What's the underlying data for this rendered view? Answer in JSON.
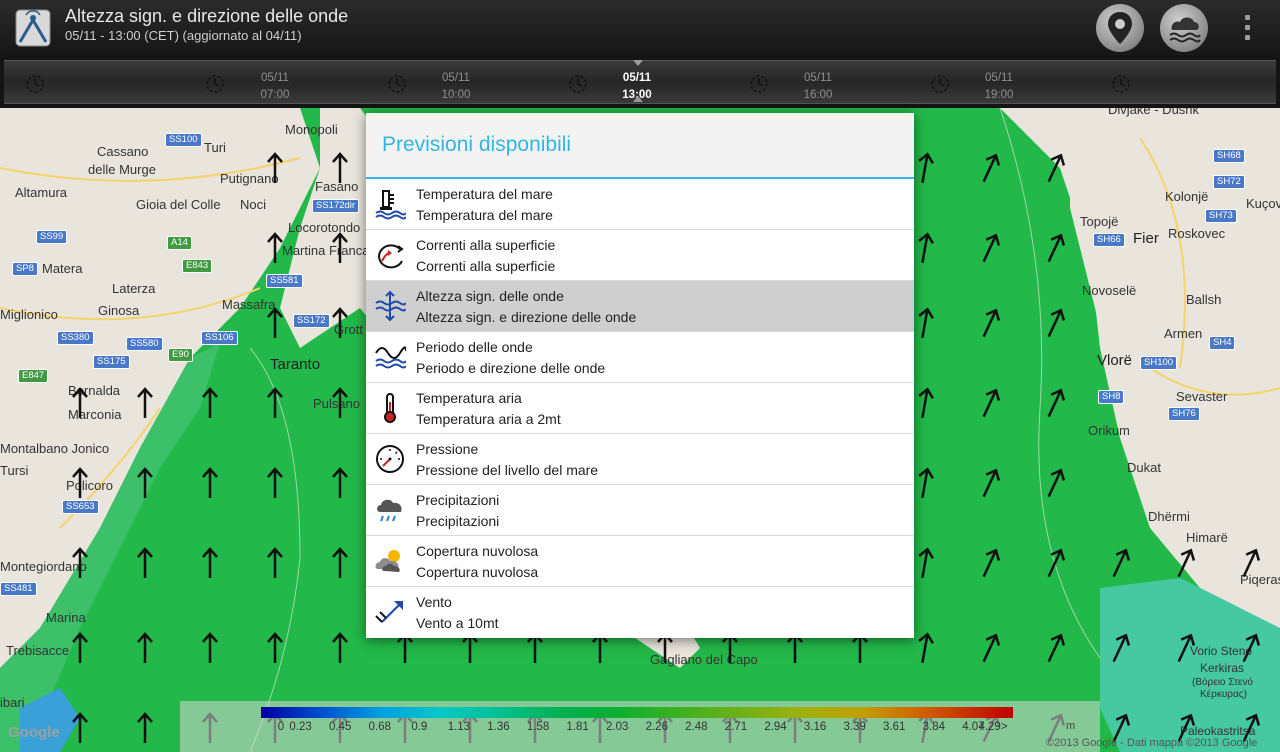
{
  "header": {
    "title": "Altezza sign. e direzione delle onde",
    "subtitle": "05/11 - 13:00 (CET) (aggiornato al 04/11)",
    "icons": [
      "app-logo-icon",
      "location-pin-icon",
      "weather-layer-icon",
      "overflow-menu-icon"
    ]
  },
  "timeline": {
    "labels": [
      {
        "date": "05/11",
        "time": "07:00",
        "active": false
      },
      {
        "date": "05/11",
        "time": "10:00",
        "active": false
      },
      {
        "date": "05/11",
        "time": "13:00",
        "active": true
      },
      {
        "date": "05/11",
        "time": "16:00",
        "active": false
      },
      {
        "date": "05/11",
        "time": "19:00",
        "active": false
      }
    ]
  },
  "map": {
    "places": [
      "Monopoli",
      "Cassano",
      "delle Murge",
      "Turi",
      "Putignano",
      "Fasano",
      "Altamura",
      "Gioia del Colle",
      "Noci",
      "Locorotondo",
      "Martina Franca",
      "Matera",
      "Laterza",
      "Massafra",
      "Miglionico",
      "Ginosa",
      "Grott",
      "Taranto",
      "Bernalda",
      "Marconia",
      "Pulsano",
      "Montalbano Jonico",
      "Tursi",
      "Policoro",
      "Montegiordano",
      "Marina",
      "Trebisacce",
      "ibari",
      "Gagliano del Capo",
      "Divjakë - Dushk",
      "Kolonjë",
      "Kuçov",
      "Topojë",
      "Fier",
      "Roskovec",
      "Novoselë",
      "Ballsh",
      "Armen",
      "Vlorë",
      "Sevaster",
      "Orikum",
      "Dukat",
      "Dhërmi",
      "Himarë",
      "Piqeras",
      "Vorio Steno",
      "Kerkiras",
      "(Βόρειο Στενό",
      "Κέρκυρας)",
      "Paleokastritsa"
    ],
    "roads": [
      "SS100",
      "SS172dir",
      "SS99",
      "A14",
      "SP8",
      "E843",
      "SS581",
      "SS172",
      "SS380",
      "SS580",
      "SS106",
      "E90",
      "SS175",
      "E847",
      "SS653",
      "SS481",
      "SH68",
      "SH72",
      "SH73",
      "SH66",
      "SH4",
      "SH100",
      "SH8",
      "SH76"
    ],
    "legend": {
      "ticks": [
        "0",
        "0.23",
        "0.45",
        "0.68",
        "0.9",
        "1.13",
        "1.36",
        "1.58",
        "1.81",
        "2.03",
        "2.26",
        "2.48",
        "2.71",
        "2.94",
        "3.16",
        "3.39",
        "3.61",
        "3.84",
        "4.07",
        "4.29>"
      ],
      "unit": "m"
    },
    "copyright": "©2013 Google - Dati mappa ©2013 Google",
    "google_logo": "Google"
  },
  "dialog": {
    "title": "Previsioni disponibili",
    "items": [
      {
        "title": "Temperatura del mare",
        "subtitle": "Temperatura del mare",
        "icon": "sea-temperature-icon",
        "selected": false
      },
      {
        "title": "Correnti alla superficie",
        "subtitle": "Correnti alla superficie",
        "icon": "surface-currents-icon",
        "selected": false
      },
      {
        "title": "Altezza sign. delle onde",
        "subtitle": "Altezza sign. e direzione delle onde",
        "icon": "wave-height-icon",
        "selected": true
      },
      {
        "title": "Periodo delle onde",
        "subtitle": "Periodo e direzione delle onde",
        "icon": "wave-period-icon",
        "selected": false
      },
      {
        "title": "Temperatura aria",
        "subtitle": "Temperatura aria a 2mt",
        "icon": "thermometer-icon",
        "selected": false
      },
      {
        "title": "Pressione",
        "subtitle": "Pressione del livello del mare",
        "icon": "barometer-icon",
        "selected": false
      },
      {
        "title": "Precipitazioni",
        "subtitle": "Precipitazioni",
        "icon": "rain-cloud-icon",
        "selected": false
      },
      {
        "title": "Copertura nuvolosa",
        "subtitle": "Copertura nuvolosa",
        "icon": "partly-cloudy-icon",
        "selected": false
      },
      {
        "title": "Vento",
        "subtitle": "Vento a 10mt",
        "icon": "wind-arrow-icon",
        "selected": false
      }
    ]
  }
}
